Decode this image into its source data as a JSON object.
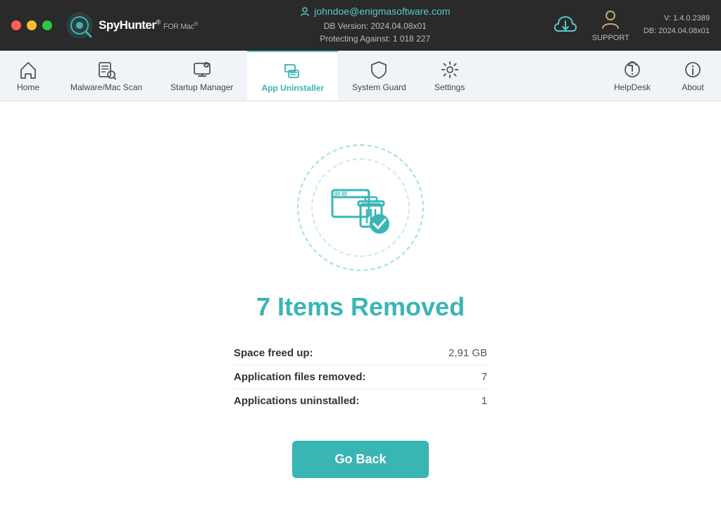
{
  "window": {
    "title": "SpyHunter for Mac"
  },
  "titlebar": {
    "user_email": "johndoe@enigmasoftware.com",
    "db_version_label": "DB Version: 2024.04.08x01",
    "protecting_label": "Protecting Against: 1 018 227",
    "support_label": "SUPPORT",
    "version_line1": "V: 1.4.0.2389",
    "version_line2": "DB:  2024.04.08x01"
  },
  "nav": {
    "items": [
      {
        "id": "home",
        "label": "Home",
        "active": false
      },
      {
        "id": "malware-scan",
        "label": "Malware/Mac Scan",
        "active": false
      },
      {
        "id": "startup-manager",
        "label": "Startup Manager",
        "active": false
      },
      {
        "id": "app-uninstaller",
        "label": "App Uninstaller",
        "active": true
      },
      {
        "id": "system-guard",
        "label": "System Guard",
        "active": false
      },
      {
        "id": "settings",
        "label": "Settings",
        "active": false
      }
    ],
    "right_items": [
      {
        "id": "helpdesk",
        "label": "HelpDesk"
      },
      {
        "id": "about",
        "label": "About"
      }
    ]
  },
  "main": {
    "result_title": "7 Items Removed",
    "stats": [
      {
        "label": "Space freed up:",
        "value": "2,91 GB"
      },
      {
        "label": "Application files removed:",
        "value": "7"
      },
      {
        "label": "Applications uninstalled:",
        "value": "1"
      }
    ],
    "go_back_label": "Go Back"
  },
  "colors": {
    "teal": "#3ab5b5",
    "teal_light": "#a8dede",
    "nav_active_bg": "#ffffff",
    "nav_bg": "#f0f4f8"
  }
}
